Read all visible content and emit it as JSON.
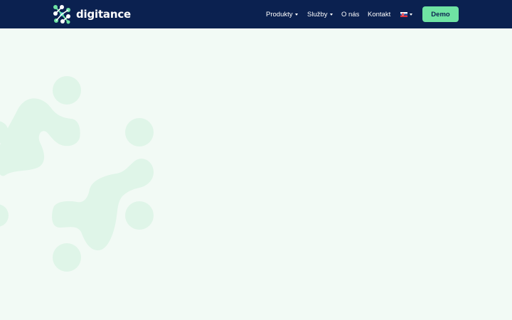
{
  "brand": {
    "name": "digitance",
    "logo_colors": [
      "#6fe3a3",
      "#ffffff",
      "#27b4c4"
    ]
  },
  "nav": {
    "items": [
      {
        "label": "Produkty",
        "has_dropdown": true
      },
      {
        "label": "Služby",
        "has_dropdown": true
      },
      {
        "label": "O nás",
        "has_dropdown": false
      },
      {
        "label": "Kontakt",
        "has_dropdown": false
      }
    ],
    "language": {
      "icon": "slovak-flag-icon",
      "has_dropdown": true
    },
    "demo_label": "Demo"
  },
  "colors": {
    "navbar": "#0b2150",
    "accent": "#6fe3a3",
    "background": "#f2faf5",
    "decor": "#dff5e8"
  }
}
